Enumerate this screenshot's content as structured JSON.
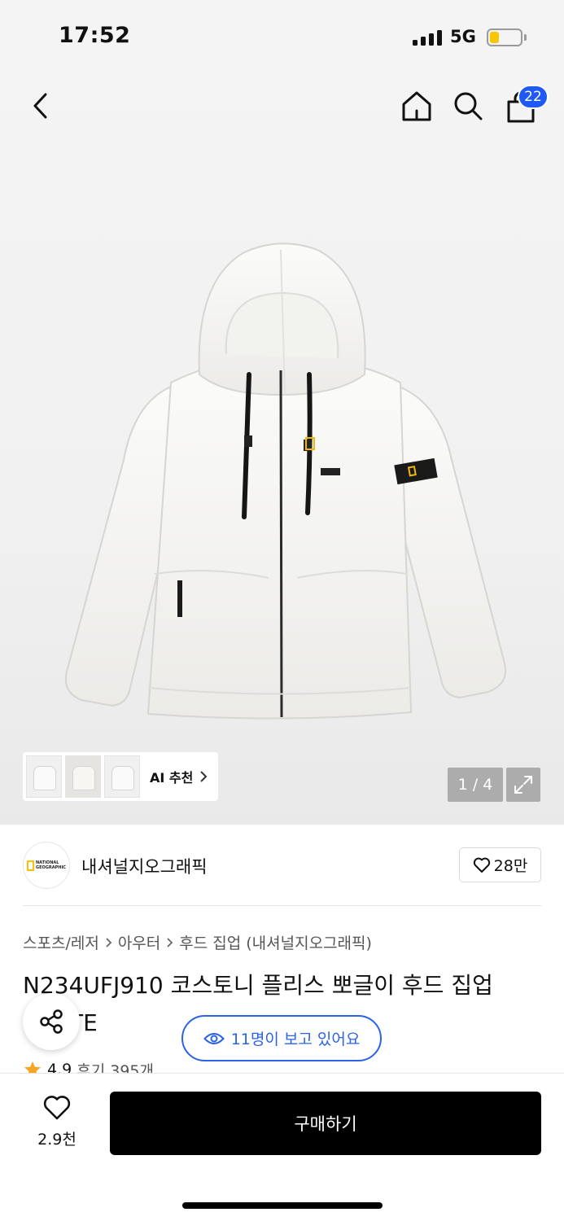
{
  "status_bar": {
    "time": "17:52",
    "network": "5G",
    "battery_level": 0.3,
    "battery_color": "#f6c700"
  },
  "nav": {
    "back_icon": "chevron-left-icon",
    "home_icon": "home-icon",
    "search_icon": "search-icon",
    "cart_icon": "shopping-bag-icon",
    "cart_count": "22"
  },
  "gallery": {
    "ai_recommend_label": "AI 추천",
    "counter": "1 / 4",
    "expand_icon": "expand-icon"
  },
  "brand": {
    "logo_text": "NATIONAL GEOGRAPHIC",
    "name": "내셔널지오그래픽",
    "like_count": "28만"
  },
  "breadcrumb": [
    "스포츠/레저",
    "아우터",
    "후드 집업 (내셔널지오그래픽)"
  ],
  "product": {
    "title": "N234UFJ910 코스토니 플리스 뽀글이 후드 집업 WHITE",
    "rating": "4.9",
    "reviews": "후기 395개"
  },
  "viewers_badge": "11명이 보고 있어요",
  "bottom_bar": {
    "wish_count": "2.9천",
    "buy_label": "구매하기"
  },
  "colors": {
    "accent_blue": "#2b62ea",
    "badge_blue": "#1f5af5",
    "star": "#f5a623"
  }
}
